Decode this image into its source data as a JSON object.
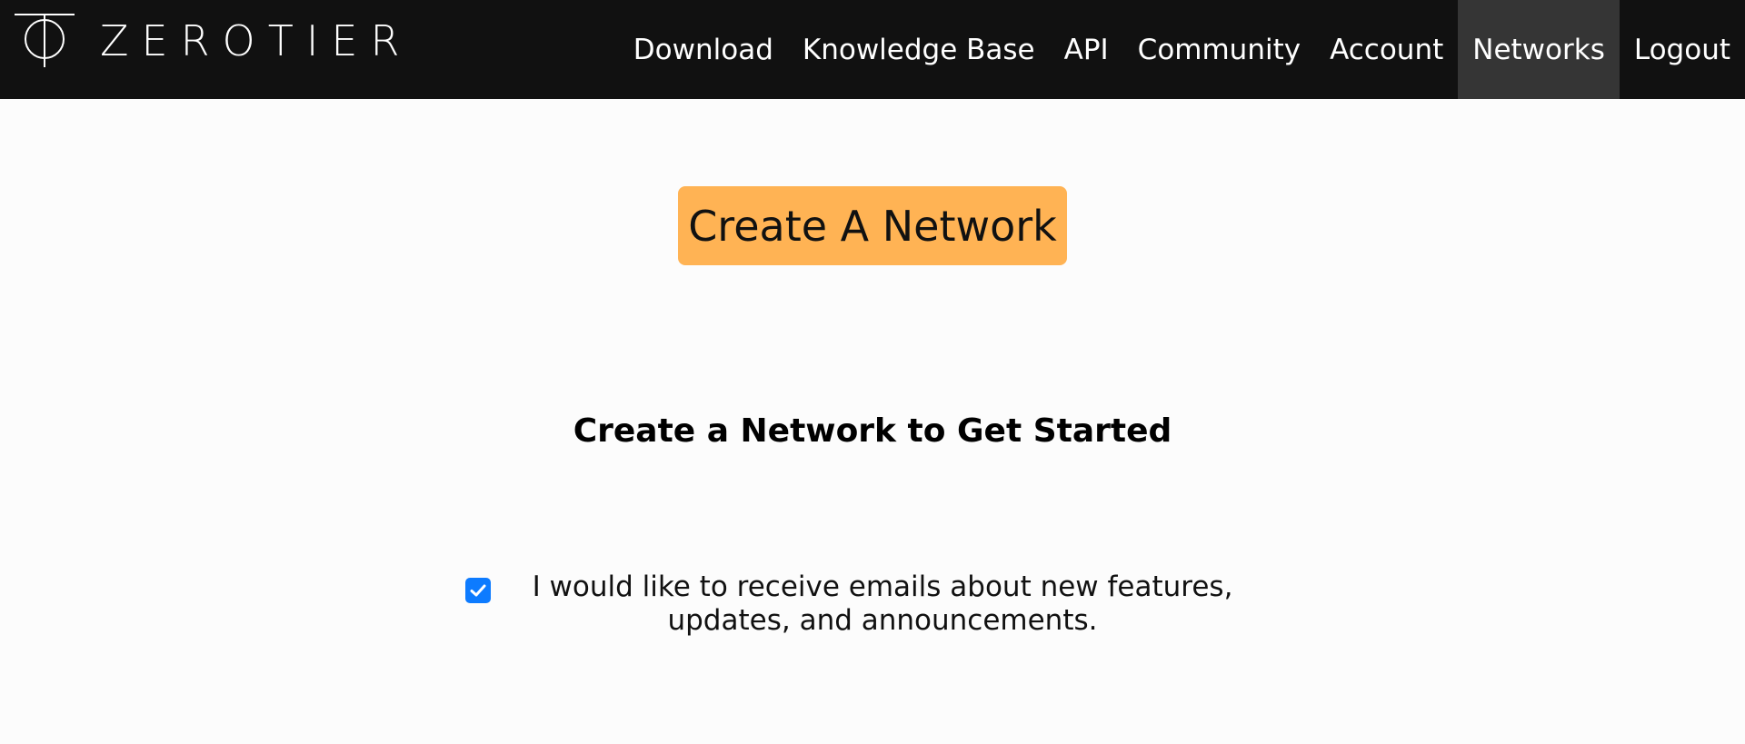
{
  "brand": {
    "name": "ZEROTIER"
  },
  "nav": {
    "items": [
      {
        "label": "Download"
      },
      {
        "label": "Knowledge Base"
      },
      {
        "label": "API"
      },
      {
        "label": "Community"
      },
      {
        "label": "Account"
      },
      {
        "label": "Networks",
        "active": true
      },
      {
        "label": "Logout"
      }
    ]
  },
  "main": {
    "create_button_label": "Create A Network",
    "heading": "Create a Network to Get Started",
    "email_optin": {
      "checked": true,
      "label": "I would like to receive emails about new features, updates, and announcements."
    }
  },
  "colors": {
    "navbar_bg": "#111111",
    "active_nav_bg": "#353535",
    "accent_button": "#ffb354",
    "checkbox": "#0d7bff"
  }
}
